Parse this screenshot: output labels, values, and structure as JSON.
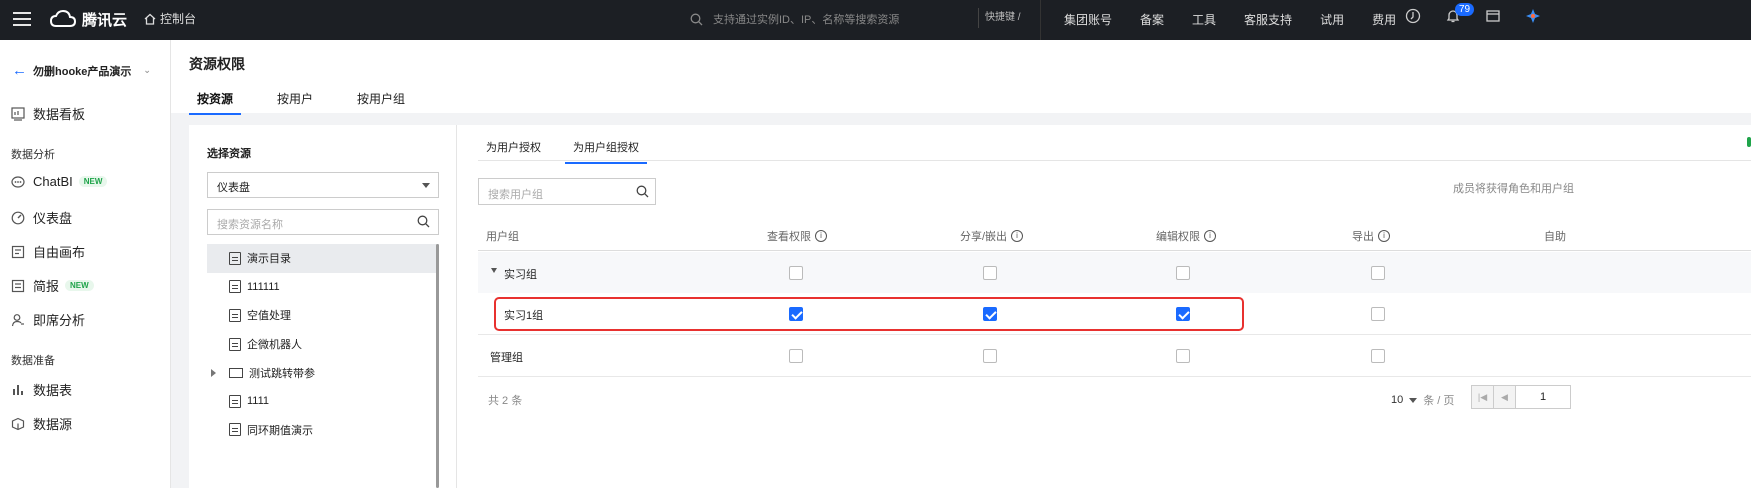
{
  "topbar": {
    "brand": "腾讯云",
    "console": "控制台",
    "search_placeholder": "支持通过实例ID、IP、名称等搜索资源",
    "shortcut": "快捷键 /",
    "nav": [
      "集团账号",
      "备案",
      "工具",
      "客服支持",
      "试用",
      "费用"
    ],
    "notification_count": "79"
  },
  "sidebar": {
    "project": "勿删hooke产品演示",
    "groups": {
      "analysis": "数据分析",
      "prepare": "数据准备"
    },
    "items": [
      {
        "label": "数据看板",
        "icon": "dashboard-icon"
      },
      {
        "label": "ChatBI",
        "badge": "NEW",
        "icon": "chatbi-icon"
      },
      {
        "label": "仪表盘",
        "icon": "gauge-icon"
      },
      {
        "label": "自由画布",
        "icon": "canvas-icon"
      },
      {
        "label": "简报",
        "badge": "NEW",
        "icon": "report-icon"
      },
      {
        "label": "即席分析",
        "icon": "adhoc-icon"
      },
      {
        "label": "数据表",
        "icon": "table-icon"
      },
      {
        "label": "数据源",
        "icon": "datasource-icon"
      }
    ]
  },
  "page": {
    "title": "资源权限",
    "tabs": [
      "按资源",
      "按用户",
      "按用户组"
    ]
  },
  "resources": {
    "label": "选择资源",
    "selected_type": "仪表盘",
    "search_placeholder": "搜索资源名称",
    "items": [
      "演示目录",
      "111111",
      "空值处理",
      "企微机器人",
      "测试跳转带参",
      "1111",
      "同环期值演示"
    ]
  },
  "auth": {
    "tabs": [
      "为用户授权",
      "为用户组授权"
    ],
    "search_placeholder": "搜索用户组",
    "hint": "成员将获得角色和用户组",
    "columns": [
      "用户组",
      "查看权限",
      "分享/嵌出",
      "编辑权限",
      "导出",
      "自助"
    ],
    "rows": [
      {
        "name": "实习组",
        "view": false,
        "share": false,
        "edit": false,
        "export": false
      },
      {
        "name": "实习1组",
        "view": true,
        "share": true,
        "edit": true,
        "export": false
      },
      {
        "name": "管理组",
        "view": false,
        "share": false,
        "edit": false,
        "export": false
      }
    ],
    "total": "共 2 条",
    "page_size": "10",
    "per_page": "条 / 页",
    "current_page": "1"
  },
  "colors": {
    "accent": "#1a6aff",
    "highlight": "#e8312f",
    "topbar": "#1c1f24"
  }
}
